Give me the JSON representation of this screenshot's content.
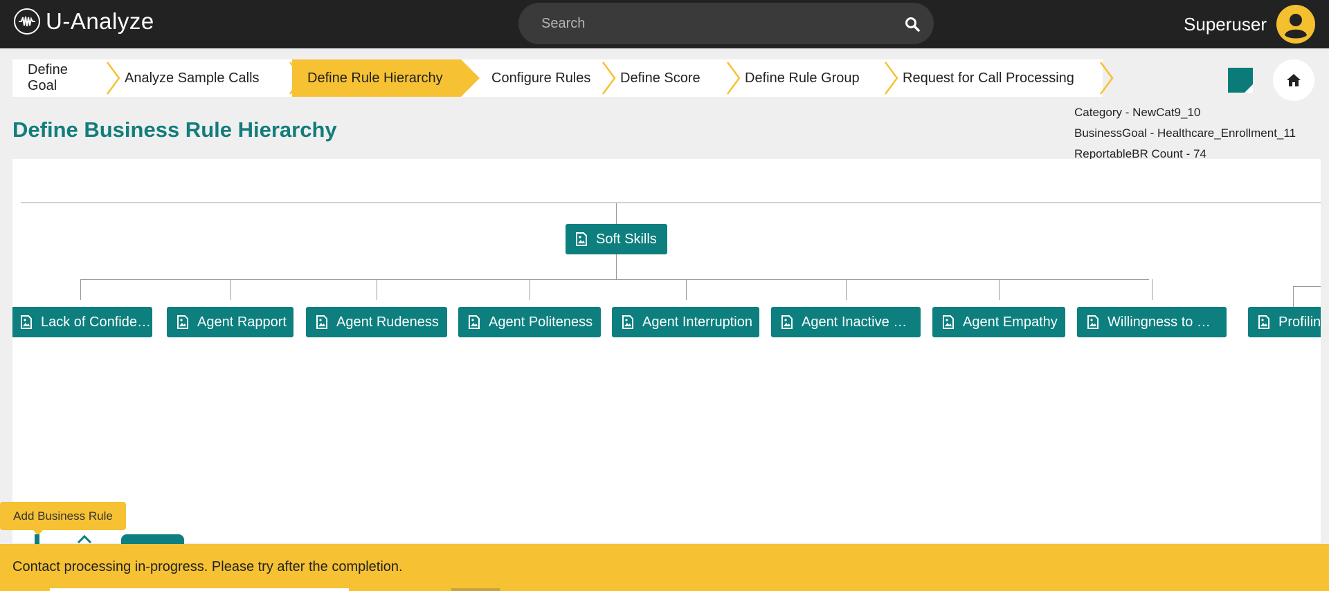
{
  "app": {
    "name": "U-Analyze"
  },
  "search": {
    "placeholder": "Search"
  },
  "user": {
    "name": "Superuser"
  },
  "steps": [
    {
      "label": "Define Goal",
      "active": false
    },
    {
      "label": "Analyze Sample Calls",
      "active": false
    },
    {
      "label": "Define Rule Hierarchy",
      "active": true
    },
    {
      "label": "Configure Rules",
      "active": false
    },
    {
      "label": "Define Score",
      "active": false
    },
    {
      "label": "Define Rule Group",
      "active": false
    },
    {
      "label": "Request for Call Processing",
      "active": false
    }
  ],
  "page": {
    "title": "Define Business Rule Hierarchy"
  },
  "info": {
    "category": "Category - NewCat9_10",
    "business_goal": "BusinessGoal - Healthcare_Enrollment_11",
    "reportable_count": "ReportableBR Count - 74"
  },
  "tree": {
    "root": "Soft Skills",
    "children": [
      "Lack of Confide…",
      "Agent Rapport",
      "Agent Rudeness",
      "Agent Politeness",
      "Agent Interruption",
      "Agent Inactive …",
      "Agent Empathy",
      "Willingness to …",
      "Profiling"
    ]
  },
  "tooltip": {
    "label": "Add Business Rule"
  },
  "toast": {
    "message": "Contact processing in-progress. Please try after the completion."
  },
  "colors": {
    "header": "#222222",
    "teal": "#0c7f7e",
    "accent": "#f6c132",
    "title": "#137c7c"
  }
}
